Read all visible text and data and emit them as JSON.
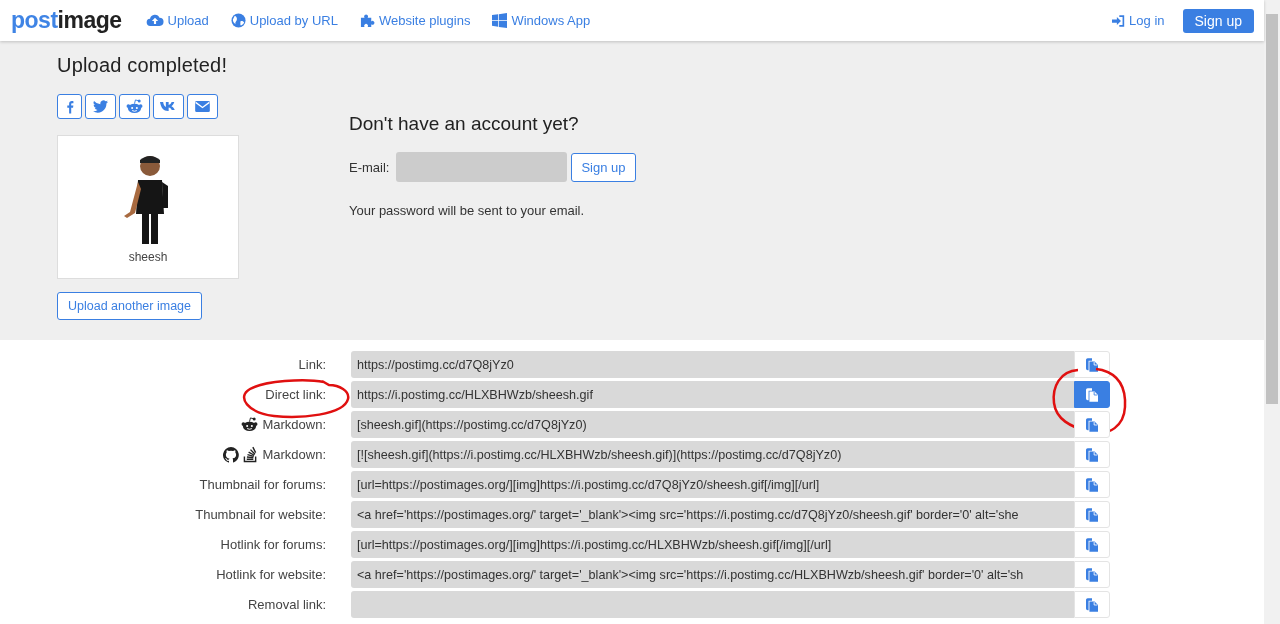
{
  "logo": {
    "accent": "post",
    "rest": "image"
  },
  "nav": [
    {
      "label": "Upload",
      "kind": "cloud"
    },
    {
      "label": "Upload by URL",
      "kind": "globe"
    },
    {
      "label": "Website plugins",
      "kind": "puzzle"
    },
    {
      "label": "Windows App",
      "kind": "windows"
    }
  ],
  "account": {
    "login": "Log in",
    "signup": "Sign up"
  },
  "title": "Upload completed!",
  "share": [
    {
      "kind": "facebook"
    },
    {
      "kind": "twitter"
    },
    {
      "kind": "reddit"
    },
    {
      "kind": "vk"
    },
    {
      "kind": "email"
    }
  ],
  "image": {
    "caption": "sheesh"
  },
  "upload_another": "Upload another image",
  "register": {
    "heading": "Don't have an account yet?",
    "email_label": "E-mail:",
    "button": "Sign up",
    "note": "Your password will be sent to your email."
  },
  "links": [
    {
      "label": "Link:",
      "value": "https://postimg.cc/d7Q8jYz0",
      "label_circled": false,
      "copy_active": false,
      "copy_circled": false
    },
    {
      "label": "Direct link:",
      "value": "https://i.postimg.cc/HLXBHWzb/sheesh.gif",
      "label_circled": true,
      "copy_active": true,
      "copy_circled": true
    },
    {
      "label": "Markdown:",
      "icons": [
        {
          "kind": "reddit"
        }
      ],
      "value": "[sheesh.gif](https://postimg.cc/d7Q8jYz0)",
      "label_circled": false,
      "copy_active": false,
      "copy_circled": false
    },
    {
      "label": "Markdown:",
      "icons": [
        {
          "kind": "github"
        },
        {
          "kind": "stack"
        }
      ],
      "value": "[![sheesh.gif](https://i.postimg.cc/HLXBHWzb/sheesh.gif)](https://postimg.cc/d7Q8jYz0)",
      "label_circled": false,
      "copy_active": false,
      "copy_circled": false
    },
    {
      "label": "Thumbnail for forums:",
      "value": "[url=https://postimages.org/][img]https://i.postimg.cc/d7Q8jYz0/sheesh.gif[/img][/url]",
      "label_circled": false,
      "copy_active": false,
      "copy_circled": false
    },
    {
      "label": "Thumbnail for website:",
      "value": "<a href='https://postimages.org/' target='_blank'><img src='https://i.postimg.cc/d7Q8jYz0/sheesh.gif' border='0' alt='she",
      "label_circled": false,
      "copy_active": false,
      "copy_circled": false
    },
    {
      "label": "Hotlink for forums:",
      "value": "[url=https://postimages.org/][img]https://i.postimg.cc/HLXBHWzb/sheesh.gif[/img][/url]",
      "label_circled": false,
      "copy_active": false,
      "copy_circled": false
    },
    {
      "label": "Hotlink for website:",
      "value": "<a href='https://postimages.org/' target='_blank'><img src='https://i.postimg.cc/HLXBHWzb/sheesh.gif' border='0' alt='sh",
      "label_circled": false,
      "copy_active": false,
      "copy_circled": false
    },
    {
      "label": "Removal link:",
      "label_circled": false,
      "copy_active": false,
      "copy_circled": false
    }
  ]
}
